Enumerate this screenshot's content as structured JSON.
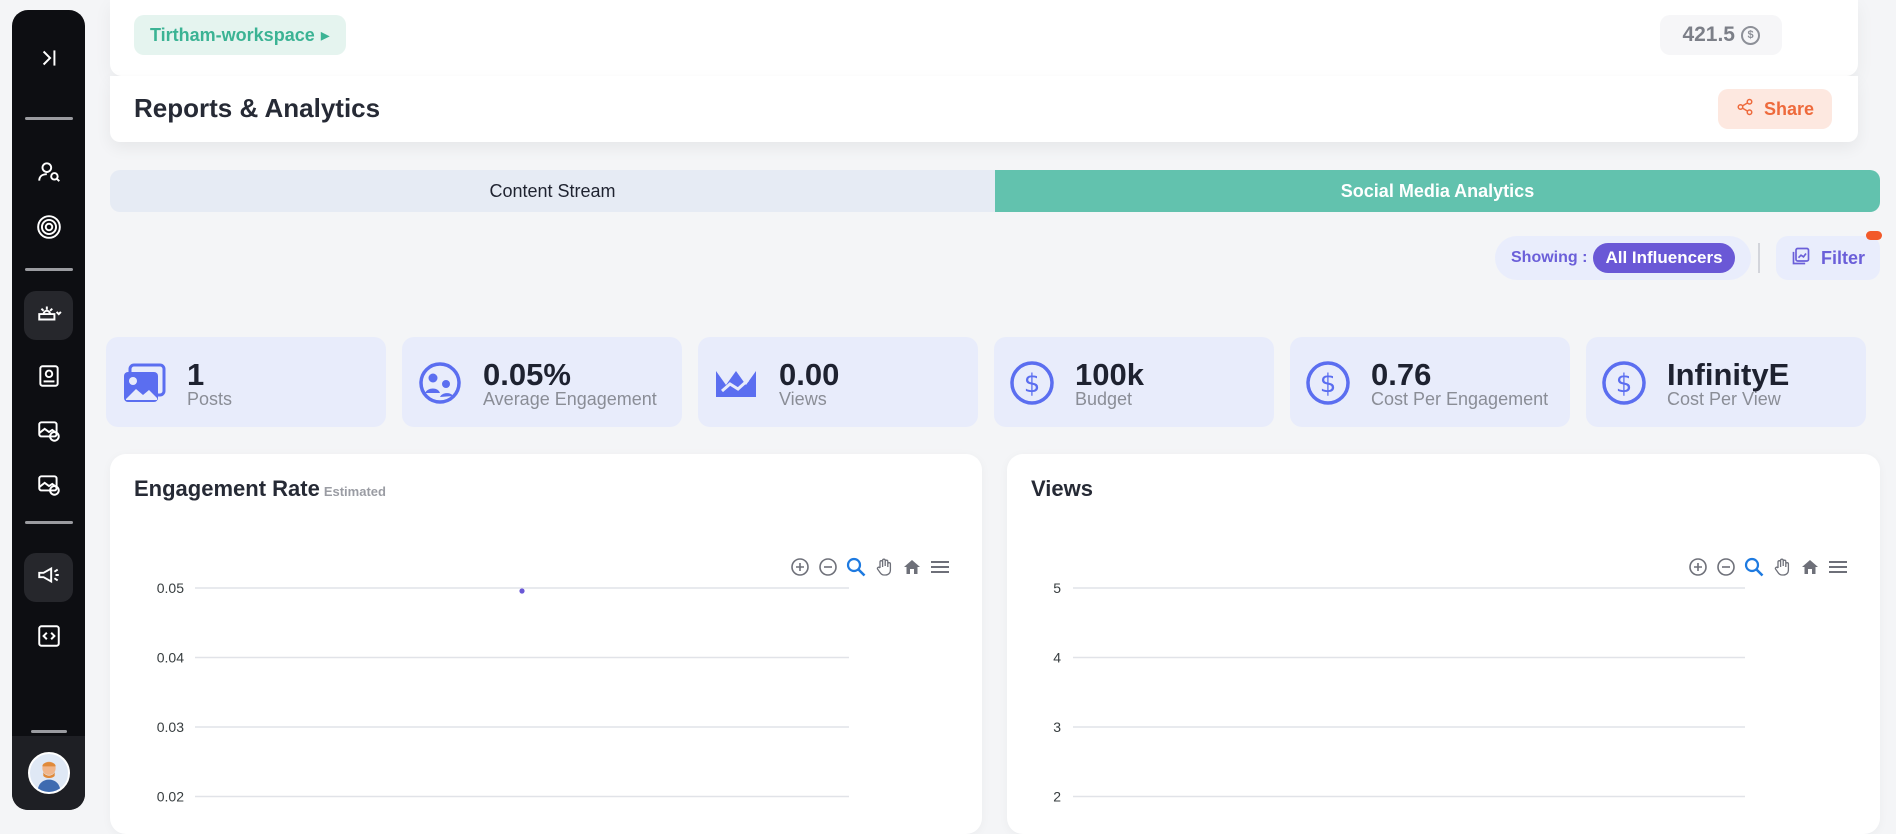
{
  "sidebar": {
    "items": [
      {
        "name": "expand-icon"
      },
      {
        "name": "user-search-icon"
      },
      {
        "name": "target-icon"
      },
      {
        "name": "campaign-icon"
      },
      {
        "name": "id-card-icon"
      },
      {
        "name": "money-image-icon"
      },
      {
        "name": "money-image-icon-2"
      },
      {
        "name": "megaphone-icon"
      },
      {
        "name": "code-icon"
      }
    ]
  },
  "topbar": {
    "workspace": "Tirtham-workspace",
    "credits": "421.5",
    "coin_symbol": "$"
  },
  "header": {
    "title": "Reports & Analytics",
    "share_label": "Share"
  },
  "tabs": [
    {
      "label": "Content Stream",
      "active": false
    },
    {
      "label": "Social Media Analytics",
      "active": true
    }
  ],
  "filters": {
    "showing_label": "Showing :",
    "showing_value": "All Influencers",
    "filter_label": "Filter"
  },
  "stats": [
    {
      "value": "1",
      "label": "Posts",
      "icon": "image-icon"
    },
    {
      "value": "0.05%",
      "label": "Average Engagement",
      "icon": "engagement-icon"
    },
    {
      "value": "0.00",
      "label": "Views",
      "icon": "crown-icon"
    },
    {
      "value": "100k",
      "label": "Budget",
      "icon": "dollar-icon"
    },
    {
      "value": "0.76",
      "label": "Cost Per Engagement",
      "icon": "dollar-icon"
    },
    {
      "value": "InfinityE",
      "label": "Cost Per View",
      "icon": "dollar-icon"
    }
  ],
  "colors": {
    "accent": "#62c2ae",
    "purple": "#6a58d6",
    "icon_blue": "#5b6ef0",
    "orange": "#ee6a3c"
  },
  "chart_data": [
    {
      "type": "scatter",
      "title": "Engagement Rate",
      "subtitle": "Estimated",
      "ylim_visible": [
        0.02,
        0.05
      ],
      "y_ticks": [
        "0.05",
        "0.04",
        "0.03",
        "0.02"
      ],
      "points": [
        {
          "y": 0.05
        }
      ],
      "grid": true
    },
    {
      "type": "line",
      "title": "Views",
      "y_ticks": [
        "5",
        "4",
        "3",
        "2"
      ],
      "points": [],
      "grid": true
    }
  ]
}
